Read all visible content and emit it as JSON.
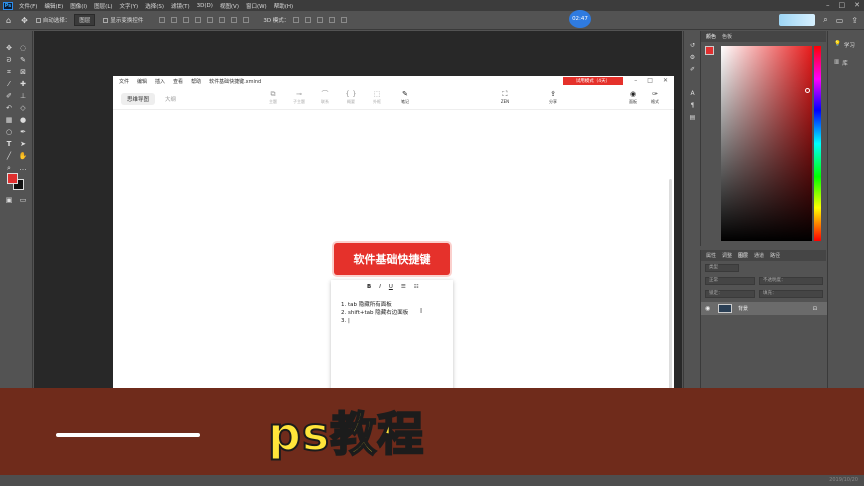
{
  "ps": {
    "menu": [
      "文件(F)",
      "编辑(E)",
      "图像(I)",
      "图层(L)",
      "文字(Y)",
      "选择(S)",
      "滤镜(T)",
      "3D(D)",
      "视图(V)",
      "窗口(W)",
      "帮助(H)"
    ],
    "logo": "Ps",
    "options": {
      "auto_select": "自动选择：",
      "auto_select_value": "图层",
      "show_transform": "显示变换控件"
    },
    "timer": "02:47",
    "panels": {
      "color_tabs": [
        "颜色",
        "色板"
      ],
      "layer_tabs": [
        "属性",
        "调整",
        "图层",
        "通道",
        "路径"
      ],
      "search_placeholder": "类型",
      "blend_mode": "正常",
      "opacity_label": "不透明度：",
      "lock_label": "锁定：",
      "fill_label": "填充：",
      "background_layer": "背景",
      "learn": "学习",
      "library": "库"
    }
  },
  "xmind": {
    "menu": [
      "文件",
      "编辑",
      "插入",
      "查看",
      "帮助"
    ],
    "file_name": "软件基础快捷键.xmind",
    "badge": "试用模式（4天）",
    "tabs": {
      "mindmap": "思维导图",
      "outline": "大纲"
    },
    "toolbar": [
      "主题",
      "子主题",
      "联系",
      "概要",
      "外框",
      "笔记",
      "ZEN",
      "分享",
      "面板",
      "格式"
    ],
    "central_topic": "软件基础快捷键",
    "note_toolbar": [
      "B",
      "I",
      "U",
      "☰",
      "☷"
    ],
    "note_lines": [
      "1.  tab  隐藏所有面板",
      "2.  shift+tab    隐藏右边面板",
      "3.  |"
    ]
  },
  "banner": {
    "title": "ps教程",
    "timestamp": "2019/10/20"
  }
}
